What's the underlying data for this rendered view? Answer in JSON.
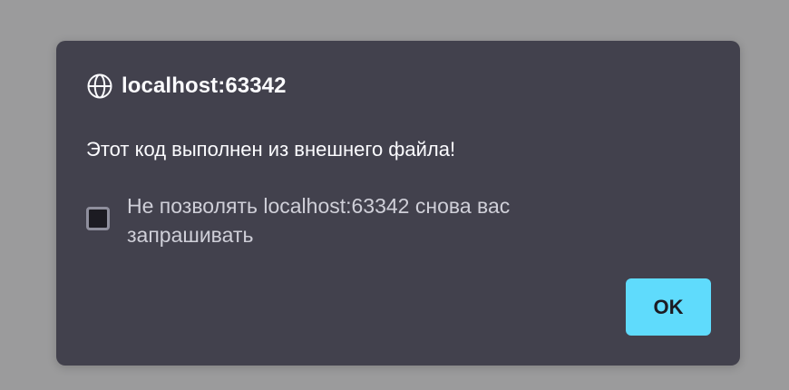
{
  "dialog": {
    "origin": "localhost:63342",
    "origin_icon": "globe-icon",
    "message": "Этот код выполнен из внешнего файла!",
    "checkbox": {
      "label": "Не позволять localhost:63342 снова вас запрашивать",
      "checked": false
    },
    "ok_label": "OK"
  },
  "colors": {
    "overlay": "#9b9b9c",
    "dialog_bg": "#42414d",
    "text_primary": "#fbfbfe",
    "text_secondary": "#cfcfd8",
    "accent": "#5fdbfc"
  }
}
